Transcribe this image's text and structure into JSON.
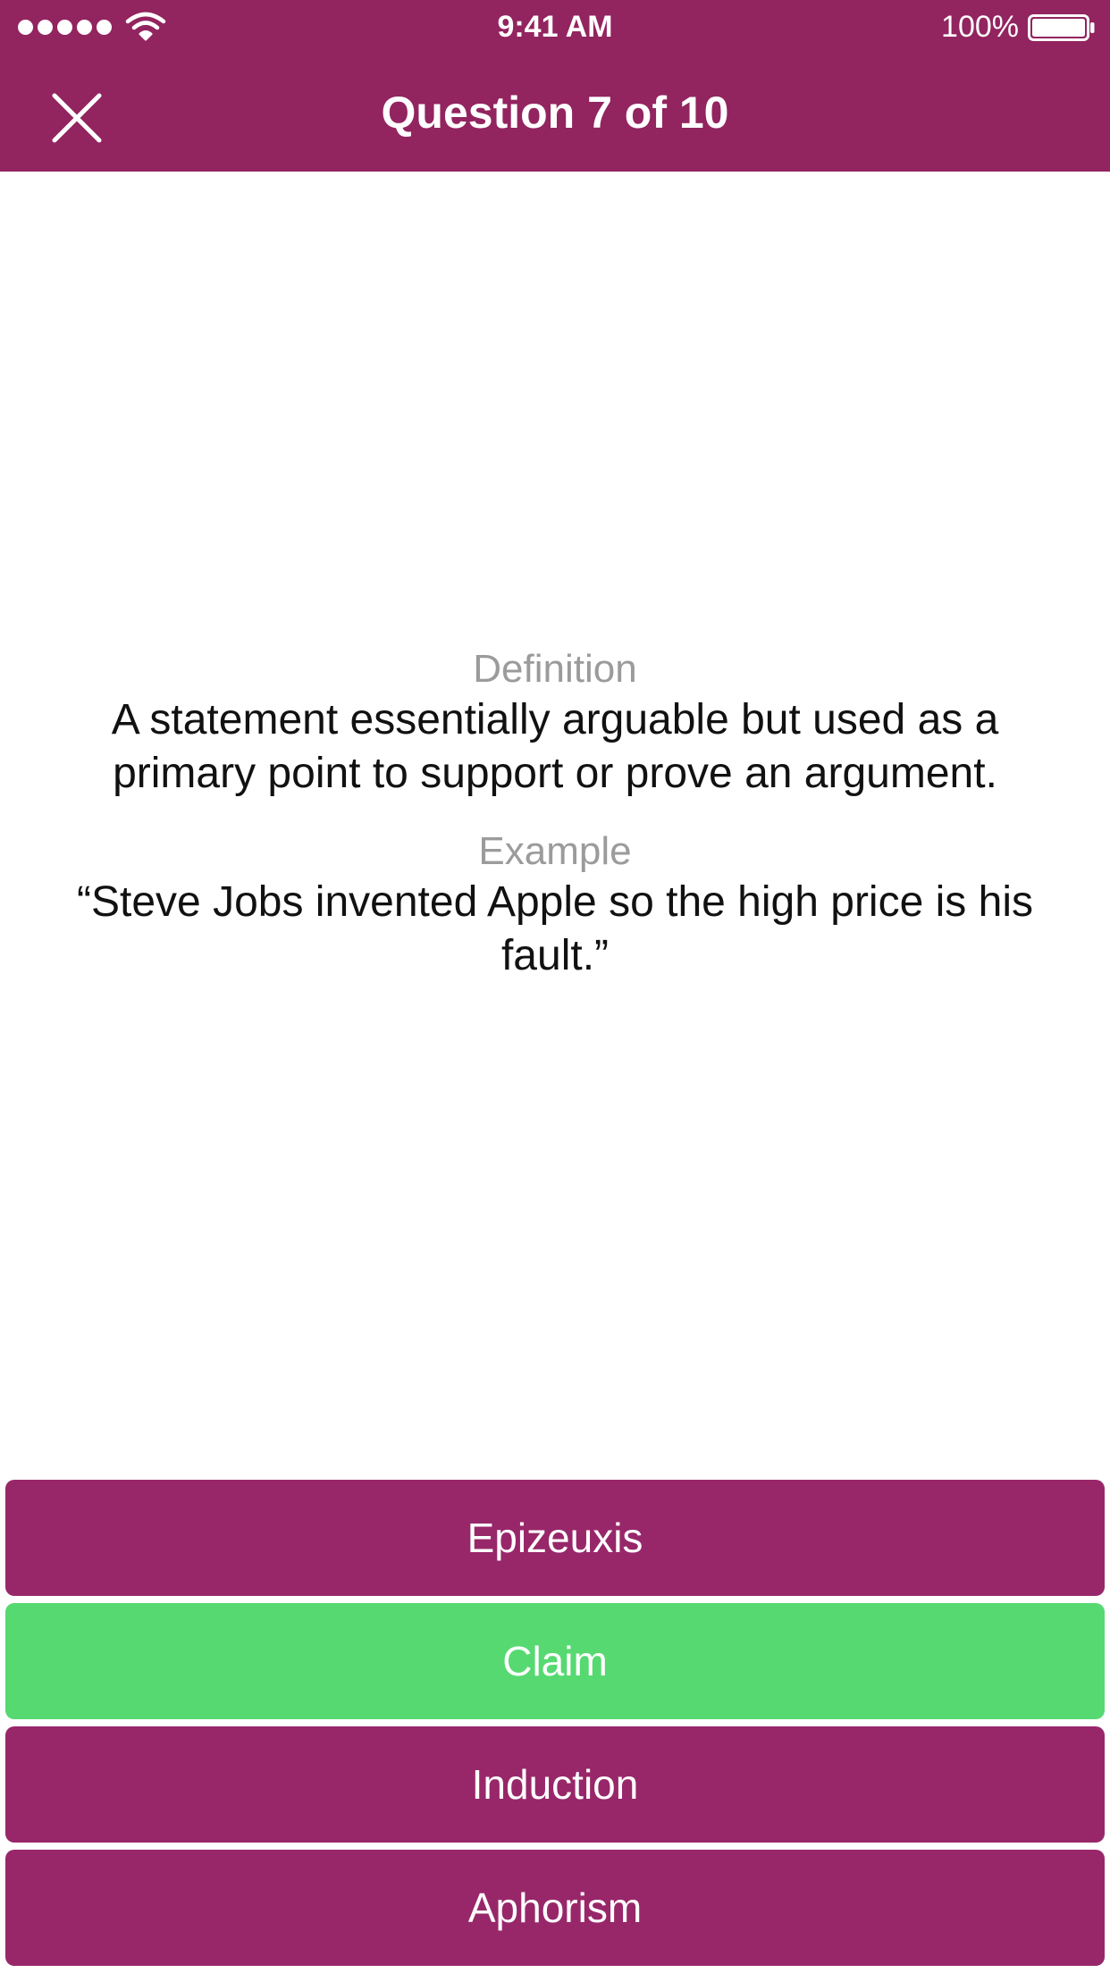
{
  "status_bar": {
    "time": "9:41 AM",
    "battery_percent": "100%",
    "signal_bars": 5,
    "wifi_icon": "wifi-icon",
    "battery_icon": "battery-full-icon"
  },
  "nav": {
    "title": "Question 7 of 10",
    "close_icon": "close-icon"
  },
  "question": {
    "definition_label": "Definition",
    "definition_text": "A statement essentially arguable but used as a primary point to support or prove an argument.",
    "example_label": "Example",
    "example_text": "“Steve Jobs invented Apple so the high price is his fault.”"
  },
  "answers": [
    {
      "label": "Epizeuxis",
      "state": "default"
    },
    {
      "label": "Claim",
      "state": "correct"
    },
    {
      "label": "Induction",
      "state": "default"
    },
    {
      "label": "Aphorism",
      "state": "default"
    }
  ],
  "colors": {
    "brand": "#92245f",
    "answer_default": "#98276a",
    "answer_correct": "#57d971",
    "label_gray": "#9b9b9b"
  }
}
